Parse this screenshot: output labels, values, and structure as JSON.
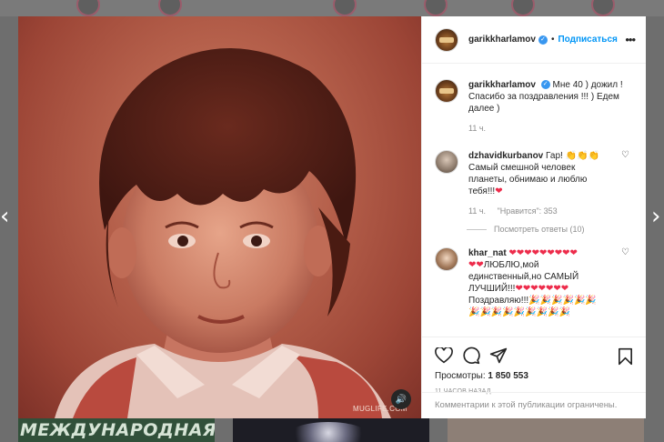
{
  "post": {
    "username": "garikkharlamov",
    "follow_label": "Подписаться",
    "separator": "•",
    "more_label": "•••",
    "caption_line1": "Мне 40 ) дожил !",
    "caption_line2": "Спасибо за поздравления !!! ) Едем",
    "caption_line3": "далее )",
    "caption_time": "11 ч.",
    "watermark": "MUGLIFE.COM"
  },
  "comments": [
    {
      "username": "dzhavidkurbanov",
      "text_line1": "Гар! 👏👏👏",
      "text_line2": "Самый смешной человек",
      "text_line3": "планеты, обнимаю и люблю",
      "text_line4": "тебя!!!",
      "time": "11 ч.",
      "likes": "\"Нравится\": 353",
      "view_replies": "Посмотреть ответы (10)"
    },
    {
      "username": "khar_nat",
      "text_line1": "ЛЮБЛЮ,мой",
      "text_line2": "единственный,но САМЫЙ",
      "text_line3": "ЛУЧШИЙ!!!",
      "text_line4": "Поздравляю!!!"
    }
  ],
  "stats": {
    "views_label": "Просмотры:",
    "views_value": "1 850 553",
    "time_ago": "11 ЧАСОВ НАЗАД"
  },
  "footer": {
    "restricted_text": "Комментарии к этой публикации ограничены."
  },
  "background": {
    "banner_text": "МЕЖДУНАРОДНАЯ"
  },
  "colors": {
    "link_blue": "#0095f6",
    "verified_blue": "#3897f0",
    "heart_red": "#ed2c4b",
    "muted_gray": "#8e8e8e"
  },
  "icons": {
    "prev": "chevron-left-icon",
    "next": "chevron-right-icon",
    "like": "heart-icon",
    "comment": "comment-icon",
    "share": "send-icon",
    "save": "bookmark-icon",
    "sound": "speaker-icon"
  }
}
